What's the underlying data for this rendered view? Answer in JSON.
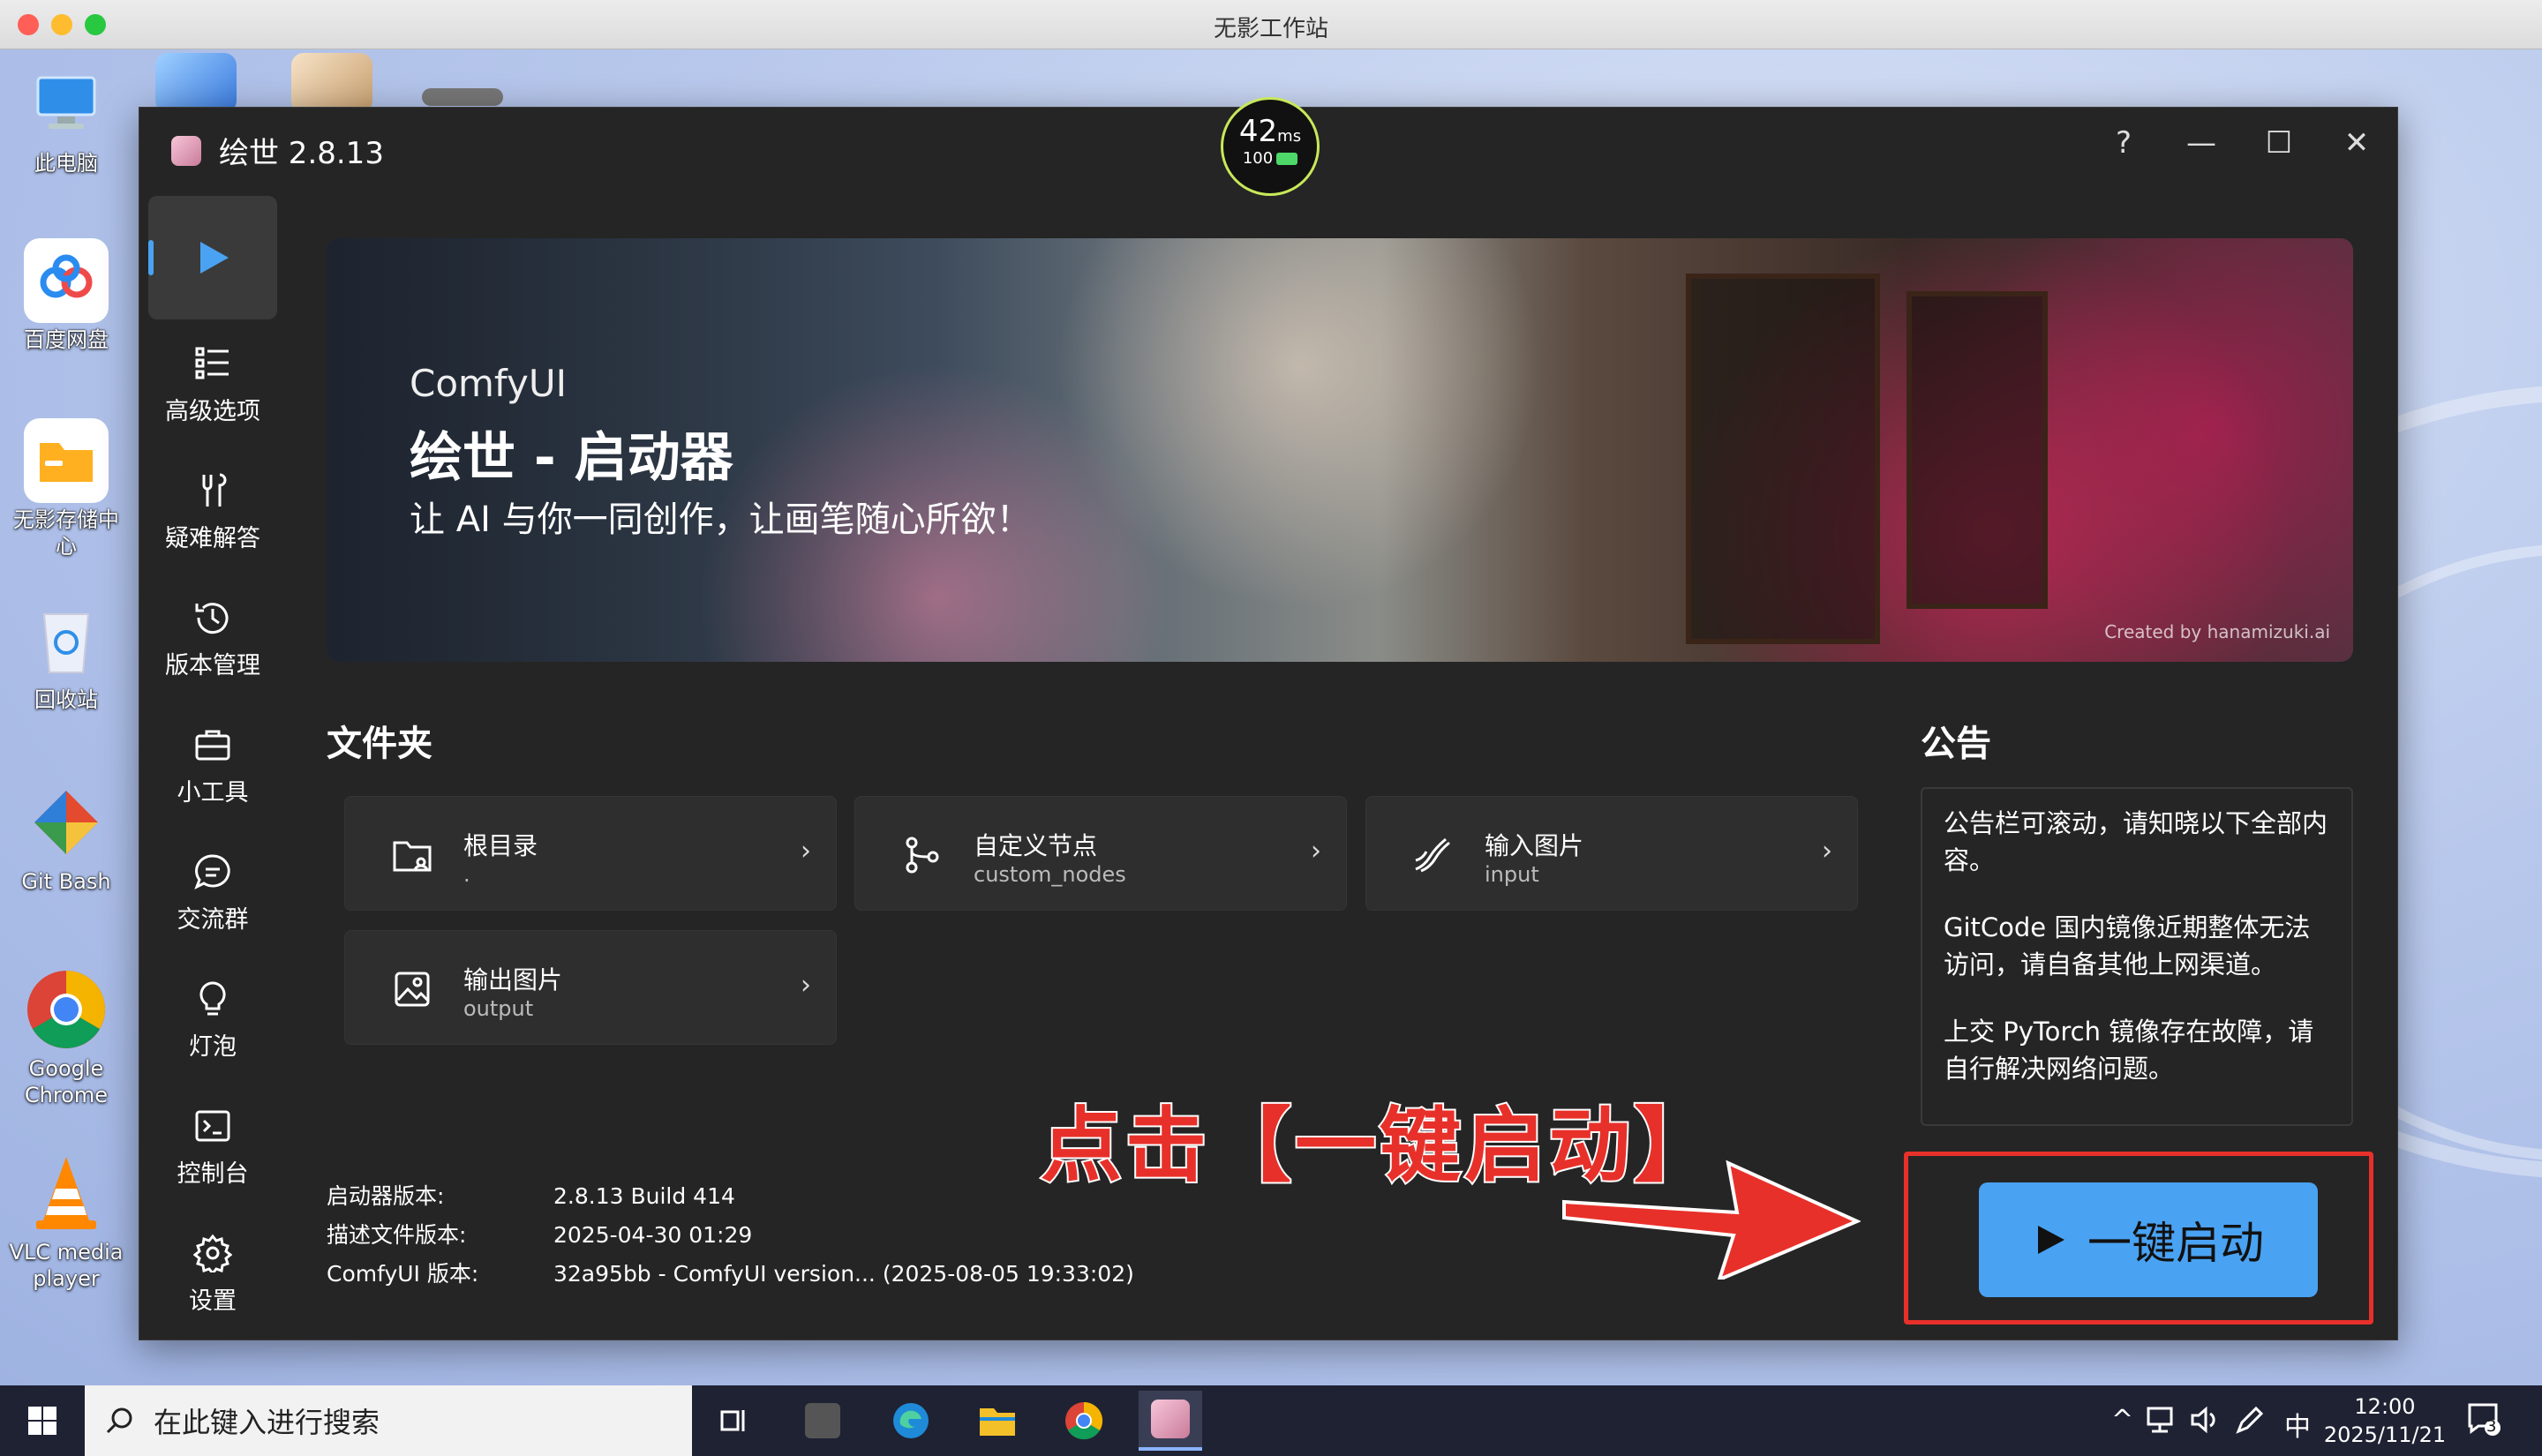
{
  "host": {
    "title": "无影工作站"
  },
  "desktop": {
    "icons": [
      {
        "label": "此电脑"
      },
      {
        "label": "百度网盘"
      },
      {
        "label": "无影存储中心"
      },
      {
        "label": "回收站"
      },
      {
        "label": "Git Bash"
      },
      {
        "label": "Google Chrome"
      },
      {
        "label": "VLC media player"
      }
    ]
  },
  "app": {
    "title": "绘世 2.8.13",
    "ping": {
      "value": "42",
      "unit": "ms",
      "battery": "100"
    },
    "controls": {
      "help": "?",
      "minimize": "—",
      "maximize": "☐",
      "close": "✕"
    }
  },
  "sidebar": {
    "items": [
      {
        "label": ""
      },
      {
        "label": "高级选项"
      },
      {
        "label": "疑难解答"
      },
      {
        "label": "版本管理"
      },
      {
        "label": "小工具"
      },
      {
        "label": "交流群"
      },
      {
        "label": "灯泡"
      },
      {
        "label": "控制台"
      },
      {
        "label": "设置"
      }
    ]
  },
  "banner": {
    "line1": "ComfyUI",
    "line2": "绘世 - 启动器",
    "line3": "让 AI 与你一同创作，让画笔随心所欲！",
    "credit": "Created by hanamizuki.ai"
  },
  "folders": {
    "title": "文件夹",
    "items": [
      {
        "name": "根目录",
        "path": "."
      },
      {
        "name": "自定义节点",
        "path": "custom_nodes"
      },
      {
        "name": "输入图片",
        "path": "input"
      },
      {
        "name": "输出图片",
        "path": "output"
      }
    ]
  },
  "versions": {
    "launcher_label": "启动器版本:",
    "launcher_value": "2.8.13 Build 414",
    "desc_label": "描述文件版本:",
    "desc_value": "2025-04-30 01:29",
    "comfy_label": "ComfyUI 版本:",
    "comfy_value": "32a95bb - ComfyUI version... (2025-08-05 19:33:02)"
  },
  "notice": {
    "title": "公告",
    "paragraphs": [
      "公告栏可滚动，请知晓以下全部内容。",
      "GitCode 国内镜像近期整体无法访问，请自备其他上网渠道。",
      "上交 PyTorch 镜像存在故障，请自行解决网络问题。"
    ]
  },
  "launch": {
    "label": "一键启动"
  },
  "annotation": {
    "text": "点击【一键启动】"
  },
  "taskbar": {
    "search_placeholder": "在此键入进行搜索",
    "ime": "中",
    "time": "12:00",
    "date": "2025/11/21",
    "notifications": "3"
  },
  "colors": {
    "accent": "#4aa2f2",
    "annotation": "#e8302a",
    "app_bg": "#252525"
  }
}
